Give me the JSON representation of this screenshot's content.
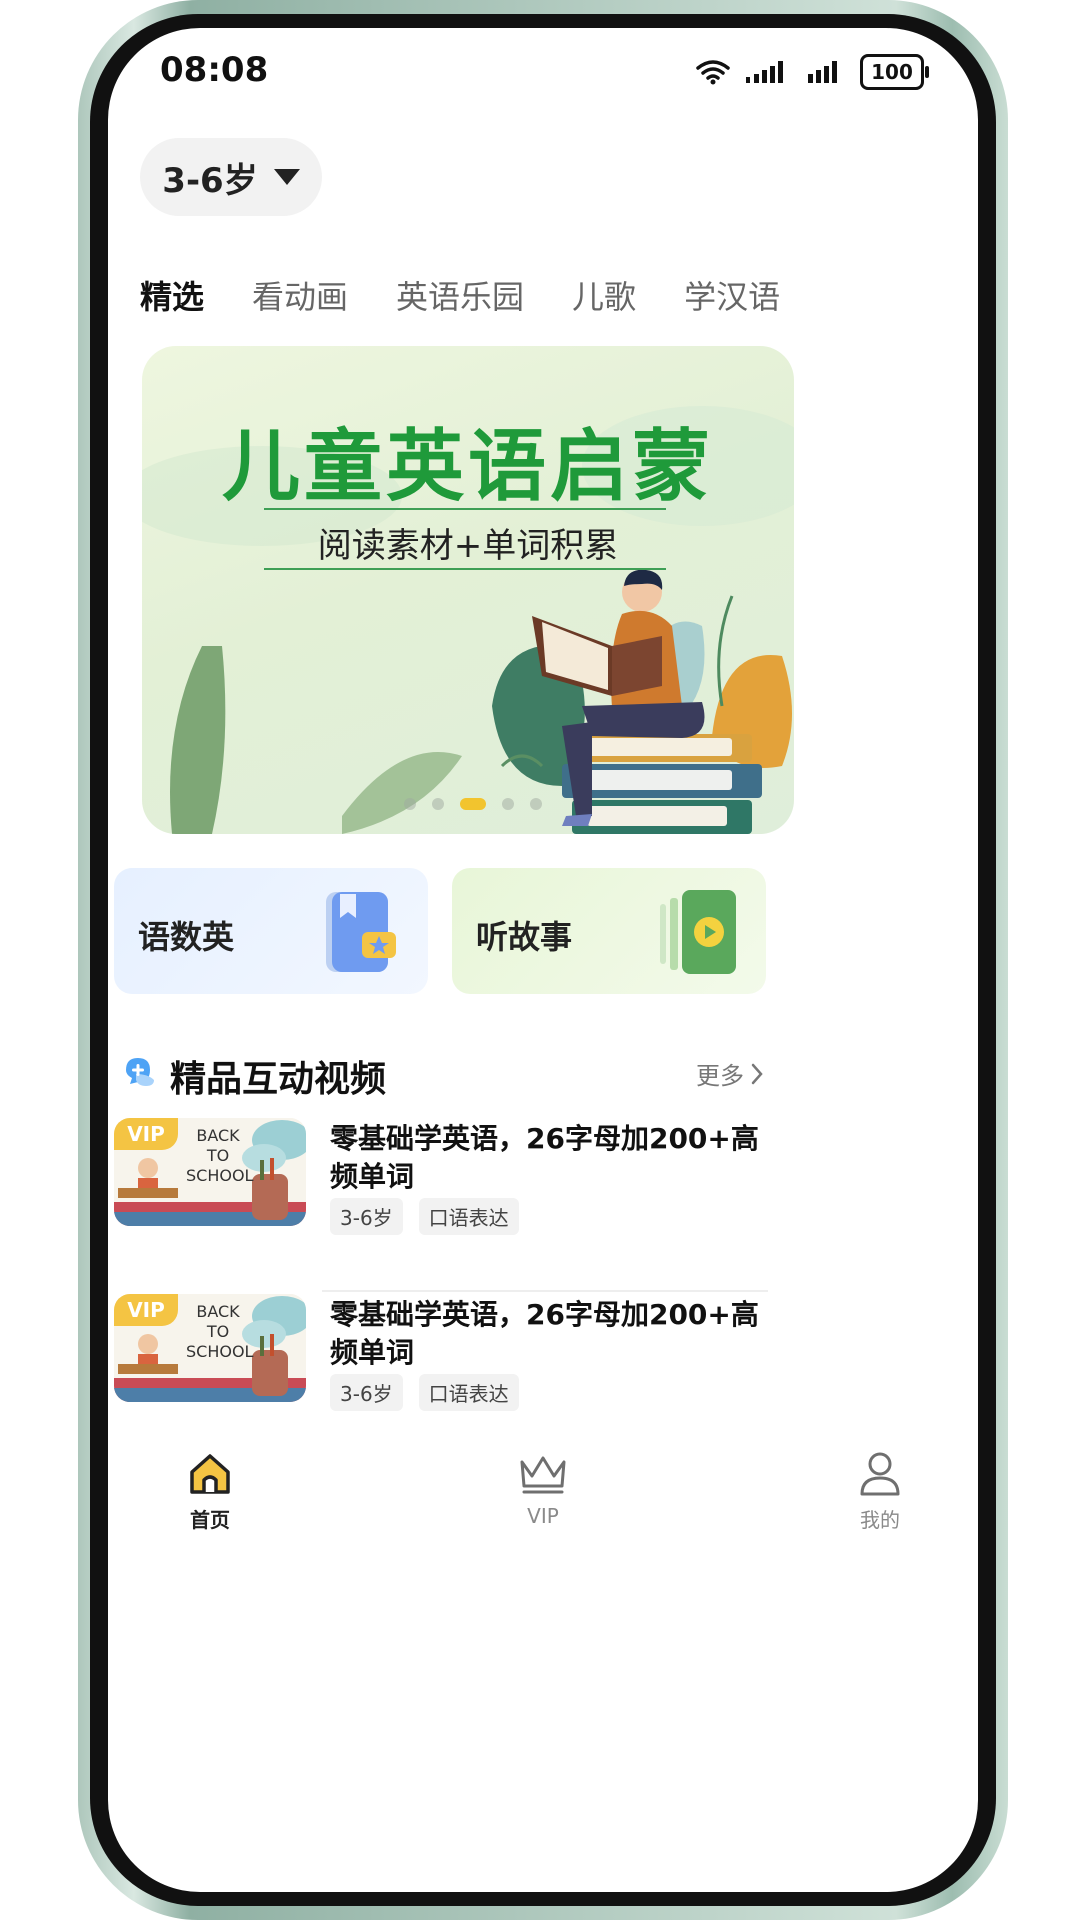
{
  "status_bar": {
    "time": "08:08",
    "battery": "100"
  },
  "age_selector": {
    "label": "3-6岁"
  },
  "tabs": [
    {
      "label": "精选",
      "active": true
    },
    {
      "label": "看动画",
      "active": false
    },
    {
      "label": "英语乐园",
      "active": false
    },
    {
      "label": "儿歌",
      "active": false
    },
    {
      "label": "学汉语",
      "active": false
    }
  ],
  "banner": {
    "title": "儿童英语启蒙",
    "subtitle": "阅读素材+单词积累",
    "page_index": 3,
    "page_count": 5
  },
  "quick_cards": [
    {
      "label": "语数英",
      "icon": "book-star-icon"
    },
    {
      "label": "听故事",
      "icon": "play-story-icon"
    }
  ],
  "section": {
    "title": "精品互动视频",
    "more": "更多"
  },
  "videos": [
    {
      "badge": "VIP",
      "thumb_text": "BACK TO SCHOOL",
      "title": "零基础学英语，26字母加200+高频单词",
      "tags": [
        "3-6岁",
        "口语表达"
      ]
    },
    {
      "badge": "VIP",
      "thumb_text": "BACK TO SCHOOL",
      "title": "零基础学英语，26字母加200+高频单词",
      "tags": [
        "3-6岁",
        "口语表达"
      ]
    }
  ],
  "bottom_nav": [
    {
      "label": "首页",
      "icon": "home-icon",
      "active": true
    },
    {
      "label": "VIP",
      "icon": "crown-icon",
      "active": false
    },
    {
      "label": "我的",
      "icon": "user-icon",
      "active": false
    }
  ],
  "colors": {
    "brand_green": "#1f9a3a",
    "vip_yellow": "#f4c443",
    "active_nav": "#222222",
    "inactive_nav": "#8a8a8a"
  }
}
